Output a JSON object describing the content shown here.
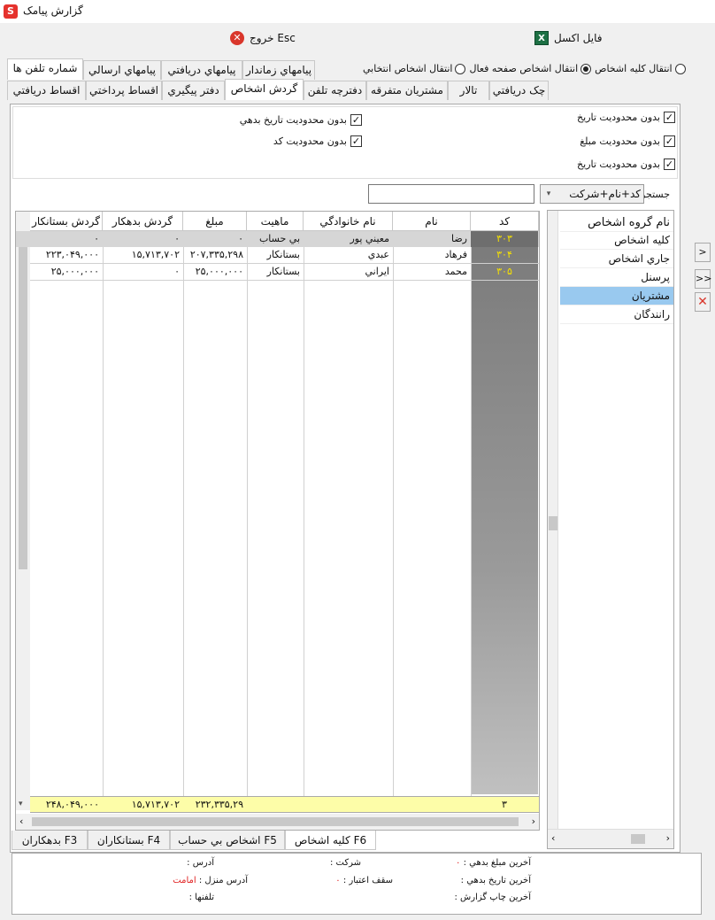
{
  "window": {
    "title": "گزارش پيامک",
    "icon": "sms-app-icon"
  },
  "toolbar": {
    "exit_label": "خروج Esc",
    "excel_label": "فايل اکسل"
  },
  "top_tabs": [
    {
      "label": "شماره تلفن ها",
      "active": true
    },
    {
      "label": "پيامهاي ارسالي",
      "active": false
    },
    {
      "label": "پيامهاي دريافتي",
      "active": false
    },
    {
      "label": "پيامهاي زماندار",
      "active": false
    }
  ],
  "transfer_options": [
    {
      "label": "انتقال کليه اشخاص",
      "checked": false
    },
    {
      "label": "انتقال اشخاص صفحه فعال",
      "checked": true
    },
    {
      "label": "انتقال اشخاص انتخابي",
      "checked": false
    }
  ],
  "sub_tabs": [
    {
      "label": "چک دريافتي",
      "active": false
    },
    {
      "label": "تالار",
      "active": false
    },
    {
      "label": "مشتريان متفرقه",
      "active": false
    },
    {
      "label": "دفترچه تلفن",
      "active": false
    },
    {
      "label": "گردش اشخاص",
      "active": true
    },
    {
      "label": "دفتر پيگيري",
      "active": false
    },
    {
      "label": "اقساط پرداختي",
      "active": false
    },
    {
      "label": "اقساط دريافتي",
      "active": false
    }
  ],
  "filters": {
    "no_date_limit_1": {
      "label": "بدون محدوديت تاريخ",
      "checked": true
    },
    "no_amount_limit": {
      "label": "بدون محدوديت مبلغ",
      "checked": true
    },
    "no_date_limit_2": {
      "label": "بدون محدوديت تاريخ",
      "checked": true
    },
    "no_debt_date_limit": {
      "label": "بدون محدوديت تاريخ بدهي",
      "checked": true
    },
    "no_code_limit": {
      "label": "بدون محدوديت کد",
      "checked": true
    }
  },
  "search": {
    "label": "جستجو",
    "mode": "کد+نام+شرکت",
    "value": ""
  },
  "groups": {
    "header": "نام گروه اشخاص",
    "items": [
      {
        "label": "کليه اشخاص",
        "selected": false
      },
      {
        "label": "جاري اشخاص",
        "selected": false
      },
      {
        "label": "پرسنل",
        "selected": false
      },
      {
        "label": "مشتريان",
        "selected": true
      },
      {
        "label": "رانندگان",
        "selected": false
      }
    ]
  },
  "grid": {
    "columns": [
      "کد",
      "نام",
      "نام خانوادگي",
      "ماهيت",
      "مبلغ",
      "گردش بدهکار",
      "گردش بستانکار"
    ],
    "filter_row": [
      "۳۰۳",
      "رضا",
      "معيني پور",
      "بي حساب",
      "۰",
      "۰",
      "۰"
    ],
    "rows": [
      [
        "۳۰۴",
        "فرهاد",
        "عبدي",
        "بستانکار",
        "۲۰۷,۳۳۵,۲۹۸",
        "۱۵,۷۱۳,۷۰۲",
        "۲۲۳,۰۴۹,۰۰۰"
      ],
      [
        "۳۰۵",
        "محمد",
        "ايراني",
        "بستانکار",
        "۲۵,۰۰۰,۰۰۰",
        "۰",
        "۲۵,۰۰۰,۰۰۰"
      ]
    ],
    "totals": {
      "count": "۳",
      "amount": "۲۳۲,۳۳۵,۲۹",
      "debit": "۱۵,۷۱۳,۷۰۲",
      "credit": "۲۴۸,۰۴۹,۰۰۰"
    }
  },
  "bottom_tabs": [
    {
      "label": "کليه اشخاص F6",
      "active": true
    },
    {
      "label": "اشخاص بي حساب F5",
      "active": false
    },
    {
      "label": "بستانکاران F4",
      "active": false
    },
    {
      "label": "بدهکاران F3",
      "active": false
    }
  ],
  "side_buttons": {
    "next": ">",
    "next_all": ">>"
  },
  "info": {
    "last_debt_amount_label": "آخرين مبلغ بدهي :",
    "last_debt_amount_value": "۰",
    "last_debt_date_label": "آخرين تاريخ بدهي :",
    "last_print_label": "آخرين چاپ گزارش :",
    "company_label": "شرکت :",
    "credit_limit_label": "سقف اعتبار :",
    "credit_limit_value": "۰",
    "address_label": "آدرس :",
    "home_address_label": "آدرس منزل :",
    "home_address_value": "امامت",
    "phones_label": "تلفنها :"
  },
  "colors": {
    "selected_row": "#99c9ef",
    "totals_bar": "#fdfda8",
    "code_column": "#8c8c8c",
    "code_text": "#f5e100"
  }
}
